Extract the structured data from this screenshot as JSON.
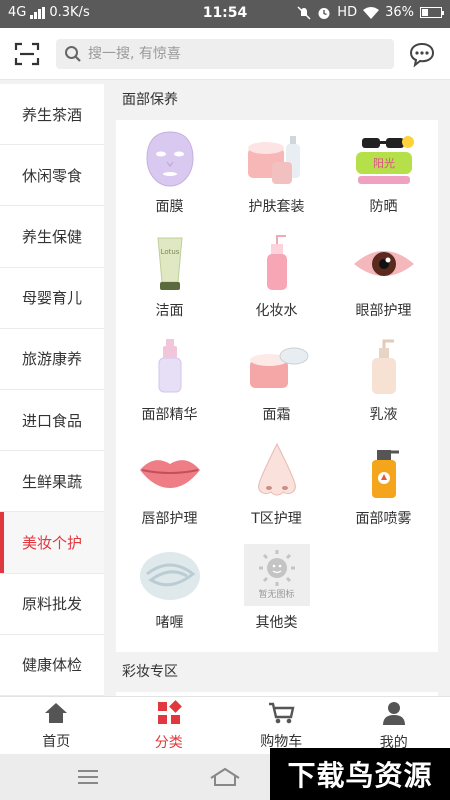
{
  "status_bar": {
    "network": "4G",
    "speed": "0.3K/s",
    "time": "11:54",
    "hd": "HD",
    "battery": "36%",
    "battery_level": 0.36
  },
  "header": {
    "search_placeholder": "搜一搜, 有惊喜"
  },
  "sidebar": {
    "items": [
      {
        "label": "养生茶酒"
      },
      {
        "label": "休闲零食"
      },
      {
        "label": "养生保健"
      },
      {
        "label": "母婴育儿"
      },
      {
        "label": "旅游康养"
      },
      {
        "label": "进口食品"
      },
      {
        "label": "生鲜果蔬"
      },
      {
        "label": "美妆个护"
      },
      {
        "label": "原料批发"
      },
      {
        "label": "健康体检"
      }
    ],
    "active_index": 7
  },
  "sections": {
    "face_care": {
      "title": "面部保养",
      "items": [
        {
          "label": "面膜",
          "icon": "face-mask-icon"
        },
        {
          "label": "护肤套装",
          "icon": "skincare-set-icon"
        },
        {
          "label": "防晒",
          "icon": "sunscreen-icon"
        },
        {
          "label": "洁面",
          "icon": "cleanser-tube-icon"
        },
        {
          "label": "化妆水",
          "icon": "toner-bottle-icon"
        },
        {
          "label": "眼部护理",
          "icon": "eye-icon"
        },
        {
          "label": "面部精华",
          "icon": "serum-bottle-icon"
        },
        {
          "label": "面霜",
          "icon": "face-cream-jar-icon"
        },
        {
          "label": "乳液",
          "icon": "lotion-pump-icon"
        },
        {
          "label": "唇部护理",
          "icon": "lips-icon"
        },
        {
          "label": "T区护理",
          "icon": "nose-icon"
        },
        {
          "label": "面部喷雾",
          "icon": "spray-bottle-icon"
        },
        {
          "label": "啫喱",
          "icon": "gel-swirl-icon"
        },
        {
          "label": "其他类",
          "icon": "placeholder-sun-icon",
          "placeholder_text": "暂无图标"
        }
      ]
    },
    "makeup": {
      "title": "彩妆专区"
    }
  },
  "bottom_nav": {
    "items": [
      {
        "label": "首页",
        "icon": "home-icon"
      },
      {
        "label": "分类",
        "icon": "category-icon"
      },
      {
        "label": "购物车",
        "icon": "cart-icon"
      },
      {
        "label": "我的",
        "icon": "user-icon"
      }
    ],
    "active_index": 1
  },
  "watermark": {
    "text": "下载鸟资源"
  },
  "colors": {
    "accent": "#e0383e"
  }
}
